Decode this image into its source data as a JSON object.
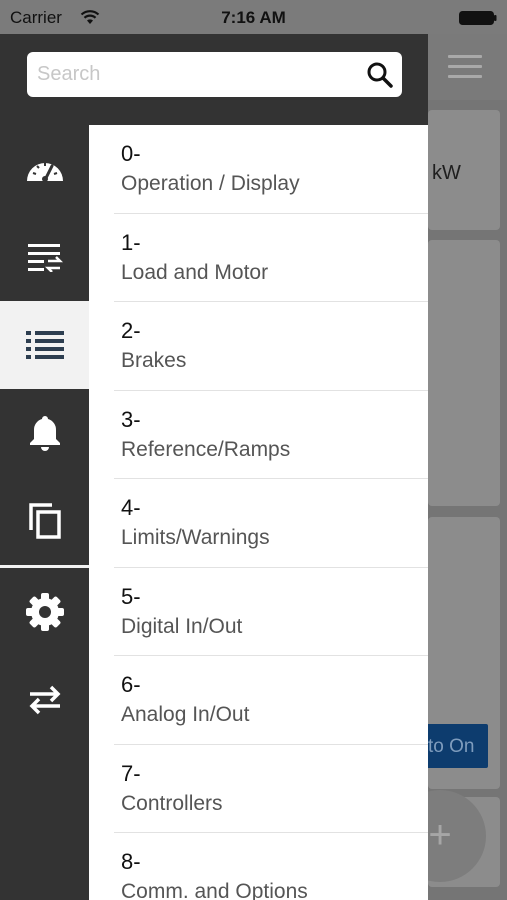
{
  "status_bar": {
    "carrier": "Carrier",
    "time": "7:16 AM"
  },
  "search": {
    "placeholder": "Search",
    "value": ""
  },
  "background": {
    "card_unit": "kW",
    "button_label": "to On",
    "fab_label": "+"
  },
  "rail": {
    "items": [
      {
        "icon": "speedometer-icon"
      },
      {
        "icon": "parameter-list-icon"
      },
      {
        "icon": "list-icon",
        "active": true
      },
      {
        "icon": "bell-icon"
      },
      {
        "icon": "copy-icon"
      },
      {
        "icon": "gear-icon"
      },
      {
        "icon": "transfer-icon"
      }
    ]
  },
  "menu": {
    "items": [
      {
        "number": "0-",
        "label": "Operation / Display"
      },
      {
        "number": "1-",
        "label": "Load and Motor"
      },
      {
        "number": "2-",
        "label": "Brakes"
      },
      {
        "number": "3-",
        "label": "Reference/Ramps"
      },
      {
        "number": "4-",
        "label": "Limits/Warnings"
      },
      {
        "number": "5-",
        "label": "Digital In/Out"
      },
      {
        "number": "6-",
        "label": "Analog In/Out"
      },
      {
        "number": "7-",
        "label": "Controllers"
      },
      {
        "number": "8-",
        "label": "Comm. and Options"
      }
    ]
  },
  "colors": {
    "drawer": "#333333",
    "accent_button": "#0d3c6e",
    "active_rail": "#f2f2f2"
  }
}
